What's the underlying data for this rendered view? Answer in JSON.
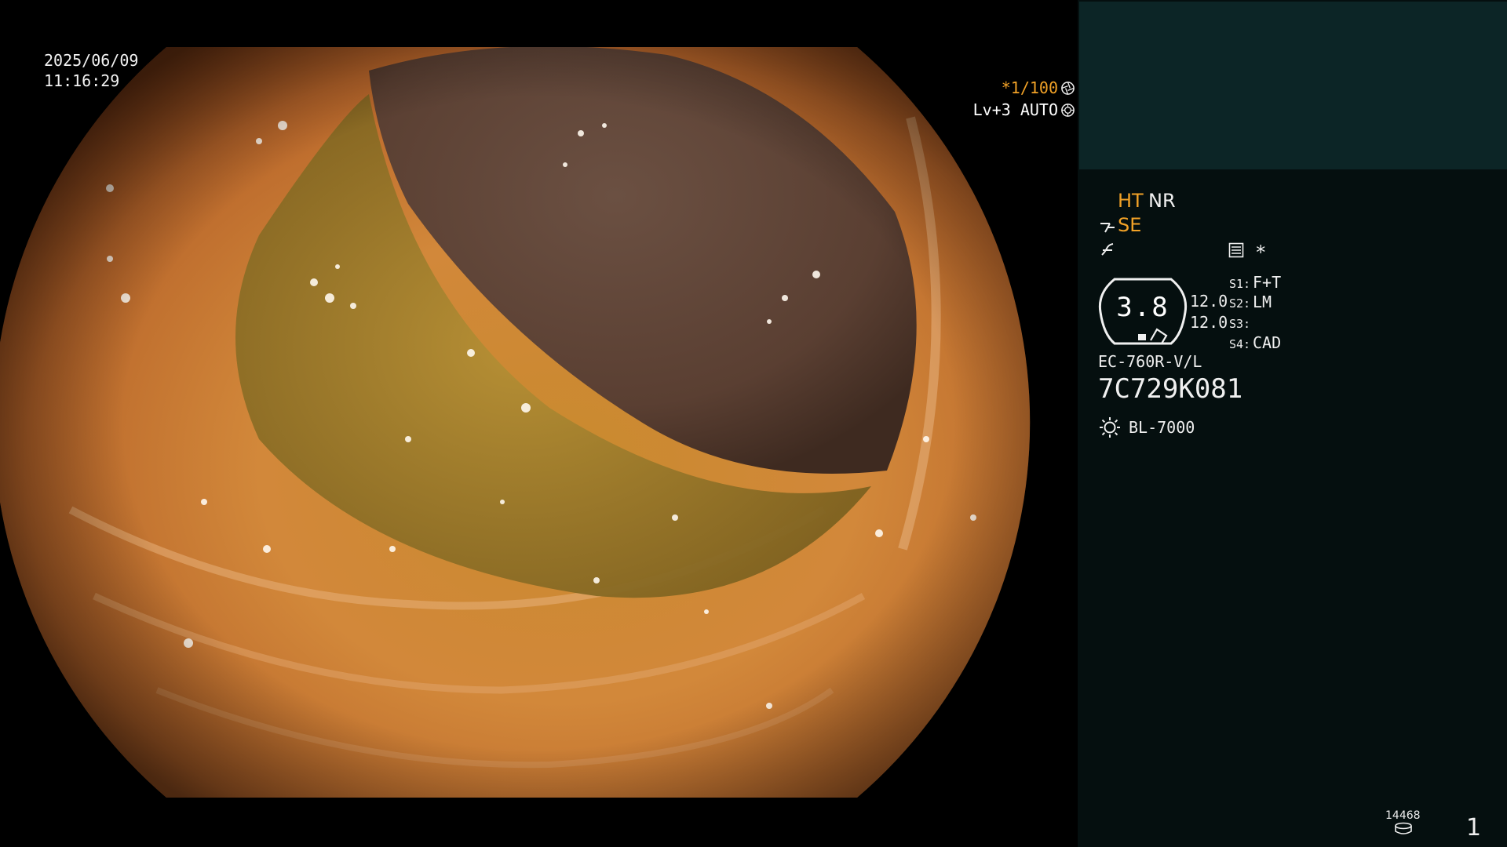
{
  "overlay": {
    "date": "2025/06/09",
    "time": "11:16:29",
    "shutter_speed": "*1/100",
    "shutter_icon": "aperture-icon",
    "iris_level": "Lv+3",
    "iris_mode": "AUTO",
    "iris_icon": "iris-icon"
  },
  "panel": {
    "ht_label": "HT",
    "nr_label": "NR",
    "se_label": "SE",
    "edge_icon": "edge-enhance-icon",
    "curve_icon": "tone-curve-icon",
    "record_icon": "record-card-icon",
    "asterisk": "*",
    "gauge_value": "3.8",
    "setting_values": [
      "12.0",
      "12.0"
    ],
    "switches": [
      {
        "key": "S1:",
        "value": "F+T"
      },
      {
        "key": "S2:",
        "value": "LM"
      },
      {
        "key": "S3:",
        "value": ""
      },
      {
        "key": "S4:",
        "value": "CAD"
      }
    ],
    "scope_model": "EC-760R-V/L",
    "scope_serial": "7C729K081",
    "light_icon": "light-source-icon",
    "light_source": "BL-7000",
    "image_count": "14468",
    "storage_icon": "storage-disk-icon",
    "page_number": "1"
  },
  "colors": {
    "accent_orange": "#f2a227",
    "panel_bg": "#050f0f",
    "preview_bg": "#0c2526"
  }
}
